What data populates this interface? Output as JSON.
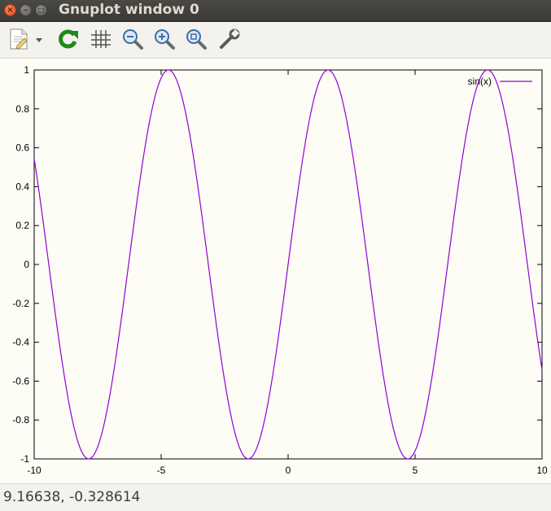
{
  "window": {
    "title": "Gnuplot window 0"
  },
  "toolbar": {
    "buttons": [
      {
        "name": "export",
        "icon": "document-export-icon"
      },
      {
        "name": "export-menu",
        "icon": "chevron-down-icon"
      },
      {
        "name": "replot",
        "icon": "refresh-icon"
      },
      {
        "name": "grid",
        "icon": "grid-icon"
      },
      {
        "name": "zoom-previous",
        "icon": "zoom-out-icon"
      },
      {
        "name": "zoom-next",
        "icon": "zoom-in-icon"
      },
      {
        "name": "autoscale",
        "icon": "zoom-fit-icon"
      },
      {
        "name": "settings",
        "icon": "wrench-icon"
      }
    ]
  },
  "status": {
    "coordinates": "9.16638, -0.328614"
  },
  "chart_data": {
    "type": "line",
    "title": "",
    "xlabel": "",
    "ylabel": "",
    "xlim": [
      -10,
      10
    ],
    "ylim": [
      -1,
      1
    ],
    "x_ticks": [
      "-10",
      "-5",
      "0",
      "5",
      "10"
    ],
    "x_tick_values": [
      -10,
      -5,
      0,
      5,
      10
    ],
    "y_ticks": [
      "1",
      "0.8",
      "0.6",
      "0.4",
      "0.2",
      "0",
      "-0.2",
      "-0.4",
      "-0.6",
      "-0.8",
      "-1"
    ],
    "y_tick_values": [
      1,
      0.8,
      0.6,
      0.4,
      0.2,
      0,
      -0.2,
      -0.4,
      -0.6,
      -0.8,
      -1
    ],
    "legend_position": "top-right",
    "series": [
      {
        "name": "sin(x)",
        "color": "#9400d3",
        "function": "sin(x)",
        "x": [
          -10,
          -9.5,
          -9,
          -8.5,
          -8,
          -7.5,
          -7,
          -6.5,
          -6,
          -5.5,
          -5,
          -4.5,
          -4,
          -3.5,
          -3,
          -2.5,
          -2,
          -1.5,
          -1,
          -0.5,
          0,
          0.5,
          1,
          1.5,
          2,
          2.5,
          3,
          3.5,
          4,
          4.5,
          5,
          5.5,
          6,
          6.5,
          7,
          7.5,
          8,
          8.5,
          9,
          9.5,
          10
        ],
        "y": [
          0.544,
          0.075,
          -0.412,
          -0.798,
          -0.989,
          -0.938,
          -0.657,
          -0.215,
          0.279,
          0.706,
          0.959,
          0.978,
          0.757,
          0.351,
          -0.141,
          -0.598,
          -0.909,
          -0.997,
          -0.841,
          -0.479,
          0,
          0.479,
          0.841,
          0.997,
          0.909,
          0.598,
          0.141,
          -0.351,
          -0.757,
          -0.978,
          -0.959,
          -0.706,
          -0.279,
          0.215,
          0.657,
          0.938,
          0.989,
          0.798,
          0.412,
          -0.075,
          -0.544
        ]
      }
    ]
  }
}
